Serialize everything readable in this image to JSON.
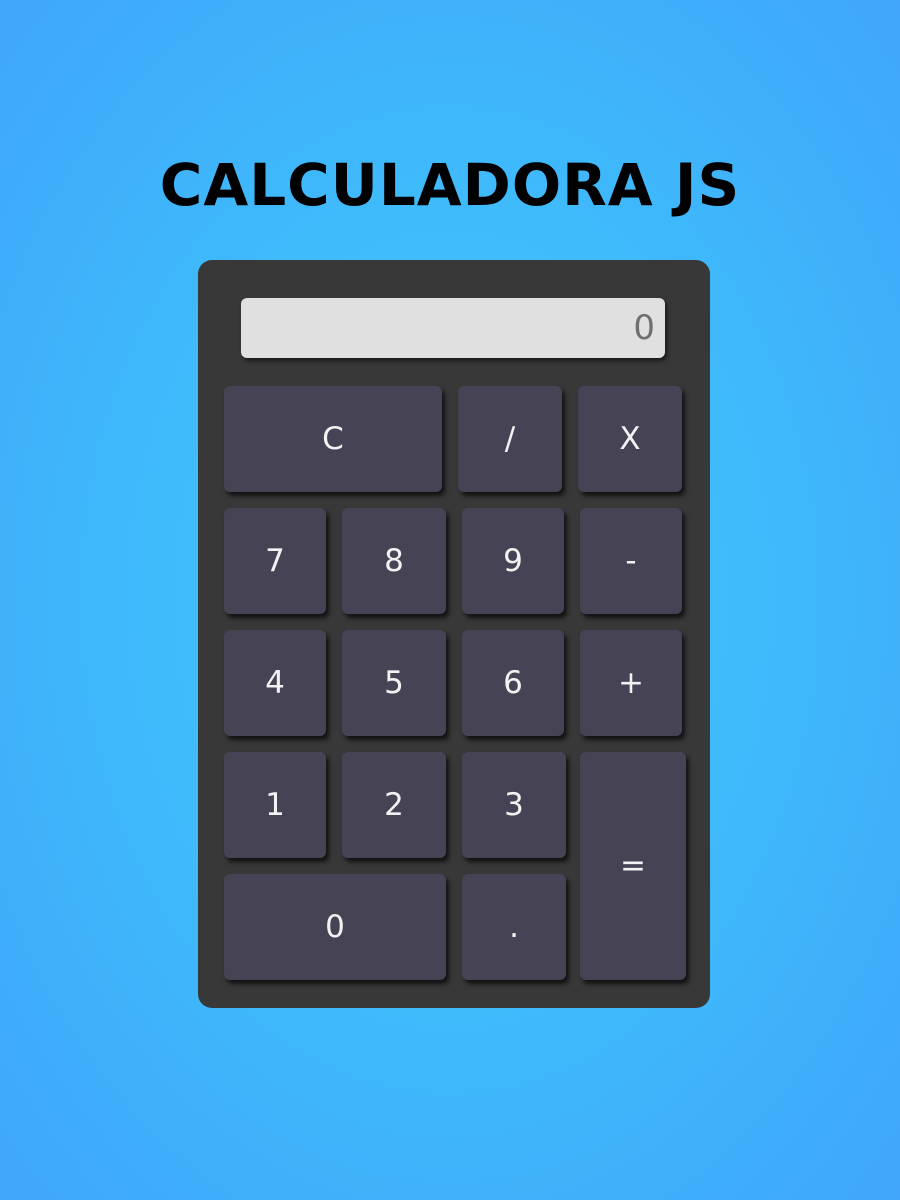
{
  "title": "CALCULADORA JS",
  "display": {
    "value": "0"
  },
  "keys": {
    "clear": "C",
    "divide": "/",
    "multiply": "X",
    "seven": "7",
    "eight": "8",
    "nine": "9",
    "minus": "-",
    "four": "4",
    "five": "5",
    "six": "6",
    "plus": "+",
    "one": "1",
    "two": "2",
    "three": "3",
    "equals": "=",
    "zero": "0",
    "dot": "."
  },
  "colors": {
    "background": "#3ec8fb",
    "body": "#383838",
    "key": "#454354",
    "display": "#e0e0e0"
  }
}
